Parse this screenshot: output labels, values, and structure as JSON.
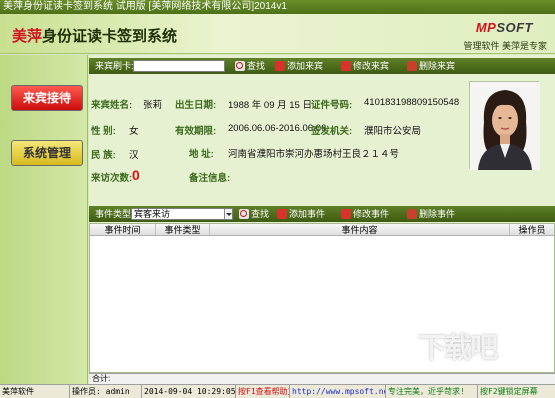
{
  "window": {
    "title": "美萍身份证读卡签到系统 试用版 [美萍网络技术有限公司]2014v1"
  },
  "header": {
    "brand": "美萍",
    "title_rest": "身份证读卡签到系统",
    "logo_main": "MP",
    "logo_sub": "SOFT",
    "slogan": "管理软件 美萍是专家"
  },
  "sidebar": {
    "items": [
      {
        "label": "来宾接待"
      },
      {
        "label": "系统管理"
      }
    ]
  },
  "guest_toolbar": {
    "card_label": "来宾刷卡:",
    "card_value": "",
    "search_label": "查找",
    "add_label": "添加来宾",
    "edit_label": "修改来宾",
    "delete_label": "删除来宾"
  },
  "guest": {
    "name_label": "来宾姓名:",
    "name": "张莉",
    "birth_label": "出生日期:",
    "birth": "1988 年 09 月 15 日",
    "id_label": "证件号码:",
    "id_number": "410183198809150548",
    "sex_label": "性    别:",
    "sex": "女",
    "valid_label": "有效期限:",
    "valid": "2006.06.06-2016.06.06",
    "authority_label": "签发机关:",
    "authority": "濮阳市公安局",
    "nation_label": "民    族:",
    "nation": "汉",
    "address_label": "地    址:",
    "address": "河南省濮阳市崇河办惠场村王良２１４号",
    "visits_label": "来访次数:",
    "visits": "0",
    "notes_label": "备注信息:",
    "notes": ""
  },
  "event_toolbar": {
    "type_label": "事件类型:",
    "type_value": "宾客来访",
    "search_label": "查找",
    "add_label": "添加事件",
    "edit_label": "修改事件",
    "delete_label": "删除事件"
  },
  "event_table": {
    "columns": [
      "事件时间",
      "事件类型",
      "事件内容",
      "操作员"
    ],
    "rows": []
  },
  "count_bar": {
    "label": "合计:"
  },
  "statusbar": {
    "software": "美萍软件",
    "operator": "操作员: admin",
    "datetime": "2014-09-04 10:29:05",
    "help": "按F1查看帮助文档",
    "url": "http://www.mpsoft.net.cn",
    "slogan": "专注完美，近乎苛求!",
    "hint": "按F2键锁定屏幕"
  },
  "watermark": {
    "text": "下载吧"
  }
}
